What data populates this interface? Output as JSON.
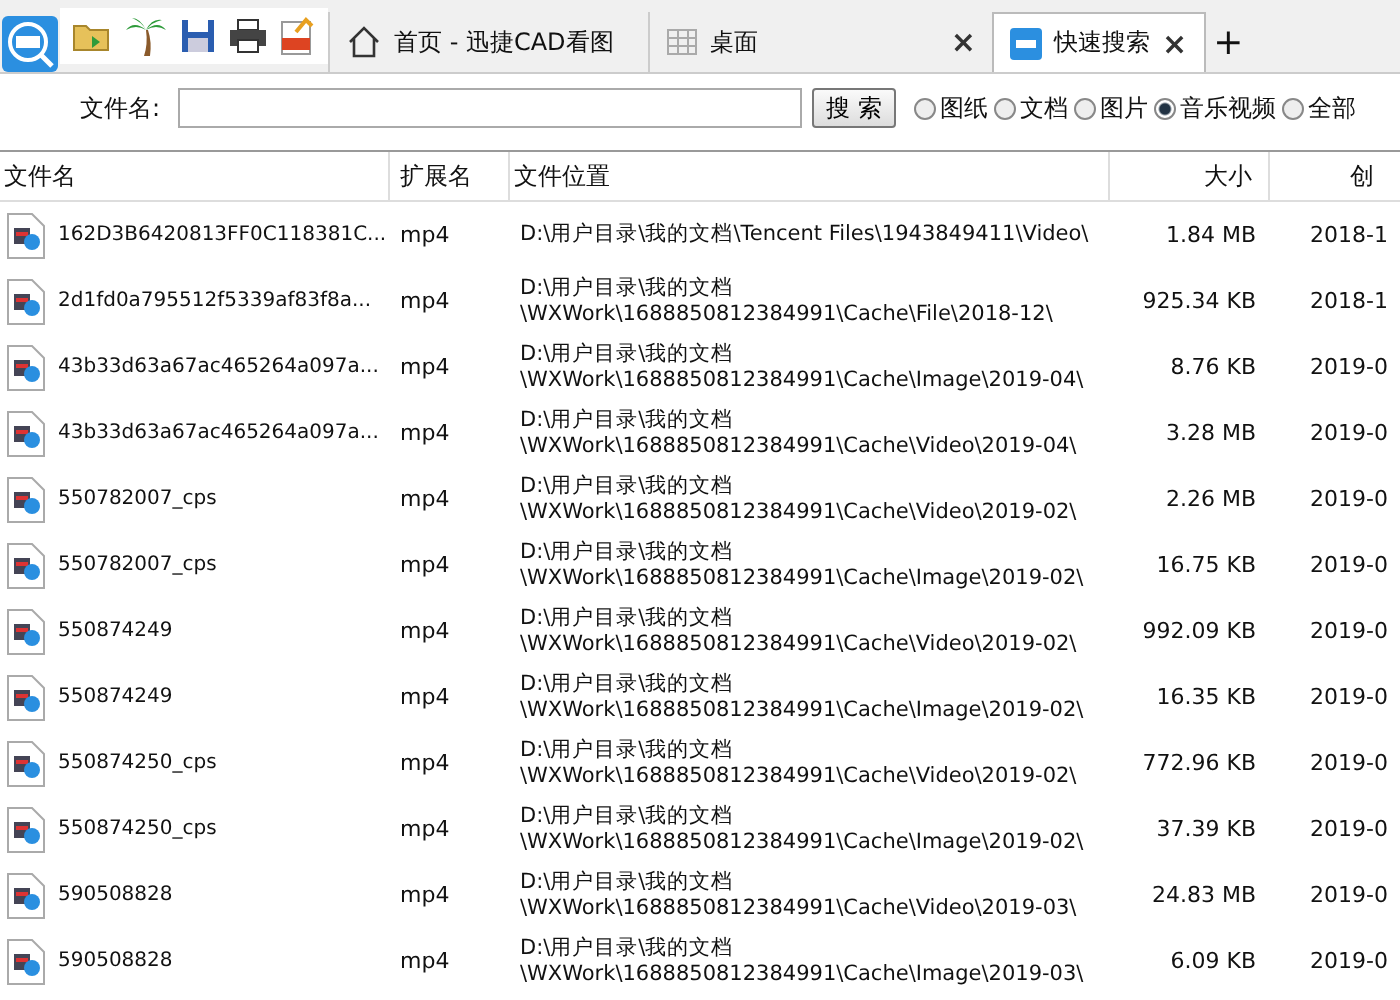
{
  "tabs": [
    {
      "label": "首页 - 迅捷CAD看图",
      "kind": "home",
      "selected": false,
      "closable": false
    },
    {
      "label": "桌面",
      "kind": "grid",
      "selected": false,
      "closable": true
    },
    {
      "label": "快速搜索",
      "kind": "cad",
      "selected": true,
      "closable": true
    }
  ],
  "new_tab": "+",
  "close_glyph": "×",
  "search": {
    "label": "文件名:",
    "button": "搜 索"
  },
  "filters": [
    {
      "label": "图纸",
      "selected": false
    },
    {
      "label": "文档",
      "selected": false
    },
    {
      "label": "图片",
      "selected": false
    },
    {
      "label": "音乐视频",
      "selected": true
    },
    {
      "label": "全部",
      "selected": false
    }
  ],
  "table": {
    "columns": [
      "文件名",
      "扩展名",
      "文件位置",
      "大小",
      "创"
    ],
    "rows": [
      {
        "name": "162D3B6420813FF0C118381C...",
        "ext": "mp4",
        "location": [
          "D:\\用户目录\\我的文档\\Tencent Files\\1943849411\\Video\\"
        ],
        "size": "1.84 MB",
        "created": "2018-1"
      },
      {
        "name": "2d1fd0a795512f5339af83f8a...",
        "ext": "mp4",
        "location": [
          "D:\\用户目录\\我的文档",
          "\\WXWork\\1688850812384991\\Cache\\File\\2018-12\\"
        ],
        "size": "925.34 KB",
        "created": "2018-1"
      },
      {
        "name": "43b33d63a67ac465264a097a...",
        "ext": "mp4",
        "location": [
          "D:\\用户目录\\我的文档",
          "\\WXWork\\1688850812384991\\Cache\\Image\\2019-04\\"
        ],
        "size": "8.76 KB",
        "created": "2019-0"
      },
      {
        "name": "43b33d63a67ac465264a097a...",
        "ext": "mp4",
        "location": [
          "D:\\用户目录\\我的文档",
          "\\WXWork\\1688850812384991\\Cache\\Video\\2019-04\\"
        ],
        "size": "3.28 MB",
        "created": "2019-0"
      },
      {
        "name": "550782007_cps",
        "ext": "mp4",
        "location": [
          "D:\\用户目录\\我的文档",
          "\\WXWork\\1688850812384991\\Cache\\Video\\2019-02\\"
        ],
        "size": "2.26 MB",
        "created": "2019-0"
      },
      {
        "name": "550782007_cps",
        "ext": "mp4",
        "location": [
          "D:\\用户目录\\我的文档",
          "\\WXWork\\1688850812384991\\Cache\\Image\\2019-02\\"
        ],
        "size": "16.75 KB",
        "created": "2019-0"
      },
      {
        "name": "550874249",
        "ext": "mp4",
        "location": [
          "D:\\用户目录\\我的文档",
          "\\WXWork\\1688850812384991\\Cache\\Video\\2019-02\\"
        ],
        "size": "992.09 KB",
        "created": "2019-0"
      },
      {
        "name": "550874249",
        "ext": "mp4",
        "location": [
          "D:\\用户目录\\我的文档",
          "\\WXWork\\1688850812384991\\Cache\\Image\\2019-02\\"
        ],
        "size": "16.35 KB",
        "created": "2019-0"
      },
      {
        "name": "550874250_cps",
        "ext": "mp4",
        "location": [
          "D:\\用户目录\\我的文档",
          "\\WXWork\\1688850812384991\\Cache\\Video\\2019-02\\"
        ],
        "size": "772.96 KB",
        "created": "2019-0"
      },
      {
        "name": "550874250_cps",
        "ext": "mp4",
        "location": [
          "D:\\用户目录\\我的文档",
          "\\WXWork\\1688850812384991\\Cache\\Image\\2019-02\\"
        ],
        "size": "37.39 KB",
        "created": "2019-0"
      },
      {
        "name": "590508828",
        "ext": "mp4",
        "location": [
          "D:\\用户目录\\我的文档",
          "\\WXWork\\1688850812384991\\Cache\\Video\\2019-03\\"
        ],
        "size": "24.83 MB",
        "created": "2019-0"
      },
      {
        "name": "590508828",
        "ext": "mp4",
        "location": [
          "D:\\用户目录\\我的文档",
          "\\WXWork\\1688850812384991\\Cache\\Image\\2019-03\\"
        ],
        "size": "6.09 KB",
        "created": "2019-0"
      }
    ]
  }
}
